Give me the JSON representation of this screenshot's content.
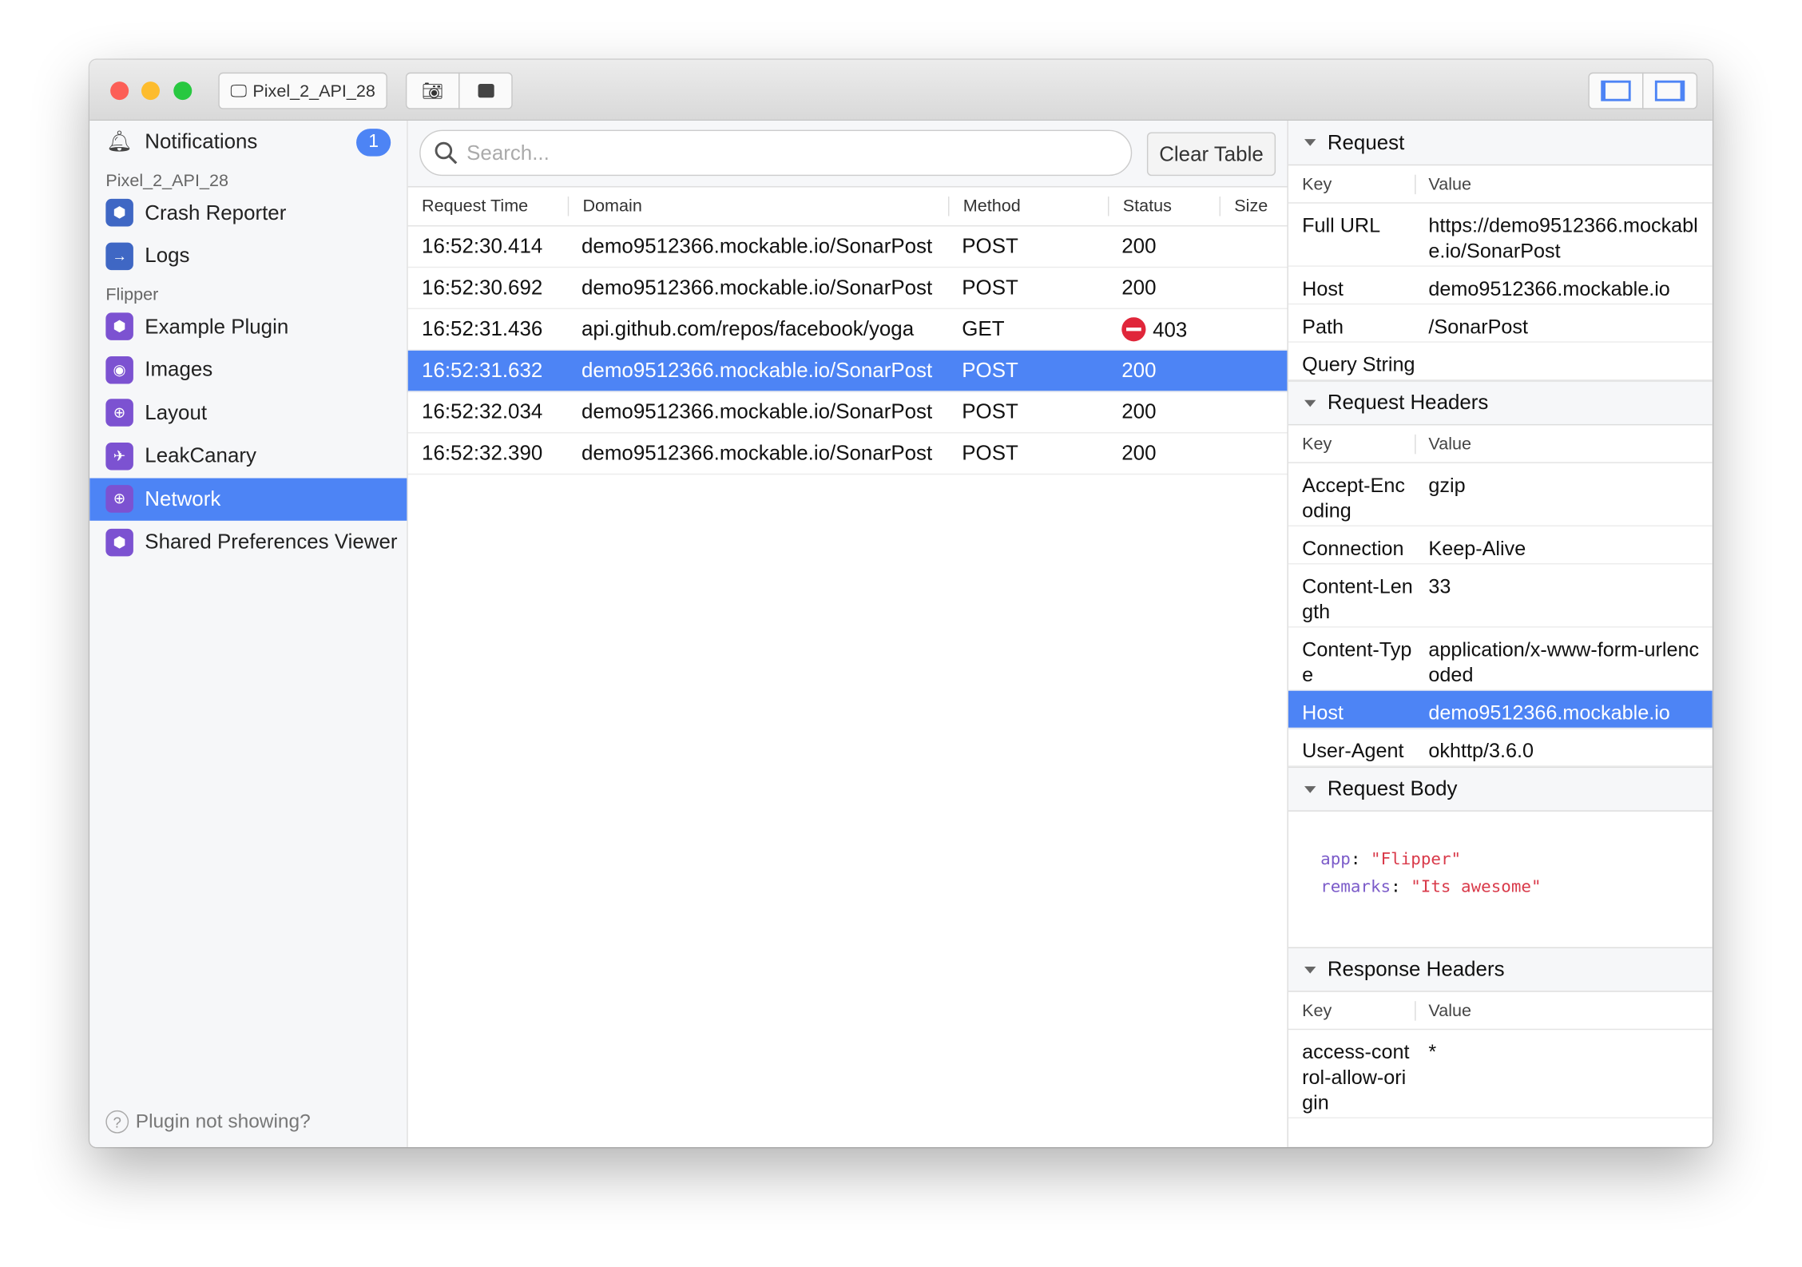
{
  "window": {
    "device": "Pixel_2_API_28",
    "accent": "#4d84f5"
  },
  "sidebar": {
    "notifications": {
      "label": "Notifications",
      "count": "1"
    },
    "groups": [
      {
        "title": "Pixel_2_API_28",
        "items": [
          {
            "label": "Crash Reporter",
            "icon": "cube-icon"
          },
          {
            "label": "Logs",
            "icon": "arrow-right-icon"
          }
        ]
      },
      {
        "title": "Flipper",
        "items": [
          {
            "label": "Example Plugin",
            "icon": "cube-icon"
          },
          {
            "label": "Images",
            "icon": "person-icon"
          },
          {
            "label": "Layout",
            "icon": "target-icon"
          },
          {
            "label": "LeakCanary",
            "icon": "bird-icon"
          },
          {
            "label": "Network",
            "icon": "globe-icon",
            "selected": true
          },
          {
            "label": "Shared Preferences Viewer",
            "icon": "cube-icon"
          }
        ]
      }
    ],
    "help": "Plugin not showing?"
  },
  "main": {
    "search_placeholder": "Search...",
    "clear_label": "Clear Table",
    "columns": [
      "Request Time",
      "Domain",
      "Method",
      "Status",
      "Size"
    ],
    "rows": [
      [
        "16:52:30.414",
        "demo9512366.mockable.io/SonarPost",
        "POST",
        "200",
        ""
      ],
      [
        "16:52:30.692",
        "demo9512366.mockable.io/SonarPost",
        "POST",
        "200",
        ""
      ],
      [
        "16:52:31.436",
        "api.github.com/repos/facebook/yoga",
        "GET",
        "403",
        ""
      ],
      [
        "16:52:31.632",
        "demo9512366.mockable.io/SonarPost",
        "POST",
        "200",
        ""
      ],
      [
        "16:52:32.034",
        "demo9512366.mockable.io/SonarPost",
        "POST",
        "200",
        ""
      ],
      [
        "16:52:32.390",
        "demo9512366.mockable.io/SonarPost",
        "POST",
        "200",
        ""
      ]
    ]
  },
  "details": {
    "key_label": "Key",
    "value_label": "Value",
    "request": {
      "title": "Request",
      "rows": [
        [
          "Full URL",
          "https://demo9512366.mockable.io/SonarPost"
        ],
        [
          "Host",
          "demo9512366.mockable.io"
        ],
        [
          "Path",
          "/SonarPost"
        ],
        [
          "Query String",
          ""
        ]
      ]
    },
    "request_headers": {
      "title": "Request Headers",
      "rows": [
        [
          "Accept-Encoding",
          "gzip"
        ],
        [
          "Connection",
          "Keep-Alive"
        ],
        [
          "Content-Length",
          "33"
        ],
        [
          "Content-Type",
          "application/x-www-form-urlencoded"
        ],
        [
          "Host",
          "demo9512366.mockable.io"
        ],
        [
          "User-Agent",
          "okhttp/3.6.0"
        ]
      ]
    },
    "request_body": {
      "title": "Request Body",
      "lines": [
        [
          "app",
          "\"Flipper\""
        ],
        [
          "remarks",
          "\"Its awesome\""
        ]
      ]
    },
    "response_headers": {
      "title": "Response Headers",
      "rows": [
        [
          "access-control-allow-origin",
          "*"
        ]
      ]
    }
  }
}
